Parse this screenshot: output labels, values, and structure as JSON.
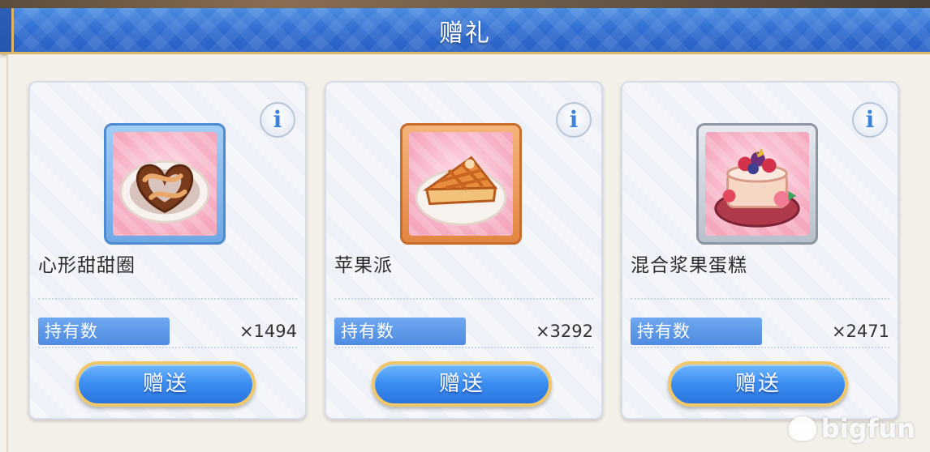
{
  "header": {
    "title": "赠礼"
  },
  "items": [
    {
      "name": "心形甜甜圈",
      "owned_label": "持有数",
      "count": "×1494",
      "button": "赠送",
      "info": "i",
      "rarity": "blue",
      "icon": "heart-donut-icon"
    },
    {
      "name": "苹果派",
      "owned_label": "持有数",
      "count": "×3292",
      "button": "赠送",
      "info": "i",
      "rarity": "orange",
      "icon": "apple-pie-icon"
    },
    {
      "name": "混合浆果蛋糕",
      "owned_label": "持有数",
      "count": "×2471",
      "button": "赠送",
      "info": "i",
      "rarity": "silver",
      "icon": "mixed-berry-cake-icon"
    }
  ],
  "watermark": "bigfun"
}
